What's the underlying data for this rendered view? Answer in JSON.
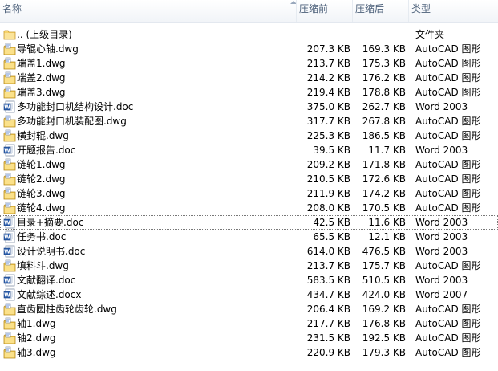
{
  "columns": {
    "name": "名称",
    "original": "压缩前",
    "compressed": "压缩后",
    "type": "类型"
  },
  "files": [
    {
      "name": ".. (上级目录)",
      "original": "",
      "compressed": "",
      "type": "文件夹",
      "icon": "folder-icon"
    },
    {
      "name": "导辊心轴.dwg",
      "original": "207.3 KB",
      "compressed": "169.3 KB",
      "type": "AutoCAD 图形",
      "icon": "dwg-file-icon"
    },
    {
      "name": "端盖1.dwg",
      "original": "213.7 KB",
      "compressed": "175.3 KB",
      "type": "AutoCAD 图形",
      "icon": "dwg-file-icon"
    },
    {
      "name": "端盖2.dwg",
      "original": "214.2 KB",
      "compressed": "176.2 KB",
      "type": "AutoCAD 图形",
      "icon": "dwg-file-icon"
    },
    {
      "name": "端盖3.dwg",
      "original": "219.4 KB",
      "compressed": "178.8 KB",
      "type": "AutoCAD 图形",
      "icon": "dwg-file-icon"
    },
    {
      "name": "多功能封口机结构设计.doc",
      "original": "375.0 KB",
      "compressed": "262.7 KB",
      "type": "Word 2003",
      "icon": "word-file-icon"
    },
    {
      "name": "多功能封口机装配图.dwg",
      "original": "317.7 KB",
      "compressed": "267.8 KB",
      "type": "AutoCAD 图形",
      "icon": "dwg-file-icon"
    },
    {
      "name": "横封辊.dwg",
      "original": "225.3 KB",
      "compressed": "186.5 KB",
      "type": "AutoCAD 图形",
      "icon": "dwg-file-icon"
    },
    {
      "name": "开题报告.doc",
      "original": "39.5 KB",
      "compressed": "11.7 KB",
      "type": "Word 2003",
      "icon": "word-file-icon"
    },
    {
      "name": "链轮1.dwg",
      "original": "209.2 KB",
      "compressed": "171.8 KB",
      "type": "AutoCAD 图形",
      "icon": "dwg-file-icon"
    },
    {
      "name": "链轮2.dwg",
      "original": "210.5 KB",
      "compressed": "172.6 KB",
      "type": "AutoCAD 图形",
      "icon": "dwg-file-icon"
    },
    {
      "name": "链轮3.dwg",
      "original": "211.9 KB",
      "compressed": "174.2 KB",
      "type": "AutoCAD 图形",
      "icon": "dwg-file-icon"
    },
    {
      "name": "链轮4.dwg",
      "original": "208.0 KB",
      "compressed": "170.5 KB",
      "type": "AutoCAD 图形",
      "icon": "dwg-file-icon"
    },
    {
      "name": "目录+摘要.doc",
      "original": "42.5 KB",
      "compressed": "11.6 KB",
      "type": "Word 2003",
      "icon": "word-file-icon"
    },
    {
      "name": "任务书.doc",
      "original": "65.5 KB",
      "compressed": "12.1 KB",
      "type": "Word 2003",
      "icon": "word-file-icon"
    },
    {
      "name": "设计说明书.doc",
      "original": "614.0 KB",
      "compressed": "476.5 KB",
      "type": "Word 2003",
      "icon": "word-file-icon"
    },
    {
      "name": "填料斗.dwg",
      "original": "213.7 KB",
      "compressed": "175.7 KB",
      "type": "AutoCAD 图形",
      "icon": "dwg-file-icon"
    },
    {
      "name": "文献翻译.doc",
      "original": "583.5 KB",
      "compressed": "510.5 KB",
      "type": "Word 2003",
      "icon": "word-file-icon"
    },
    {
      "name": "文献综述.docx",
      "original": "434.7 KB",
      "compressed": "424.0 KB",
      "type": "Word 2007",
      "icon": "word-file-icon"
    },
    {
      "name": "直齿圆柱齿轮齿轮.dwg",
      "original": "206.4 KB",
      "compressed": "169.2 KB",
      "type": "AutoCAD 图形",
      "icon": "dwg-file-icon"
    },
    {
      "name": "轴1.dwg",
      "original": "217.7 KB",
      "compressed": "176.8 KB",
      "type": "AutoCAD 图形",
      "icon": "dwg-file-icon"
    },
    {
      "name": "轴2.dwg",
      "original": "231.5 KB",
      "compressed": "192.5 KB",
      "type": "AutoCAD 图形",
      "icon": "dwg-file-icon"
    },
    {
      "name": "轴3.dwg",
      "original": "220.9 KB",
      "compressed": "179.3 KB",
      "type": "AutoCAD 图形",
      "icon": "dwg-file-icon"
    }
  ],
  "focused_row": 13
}
